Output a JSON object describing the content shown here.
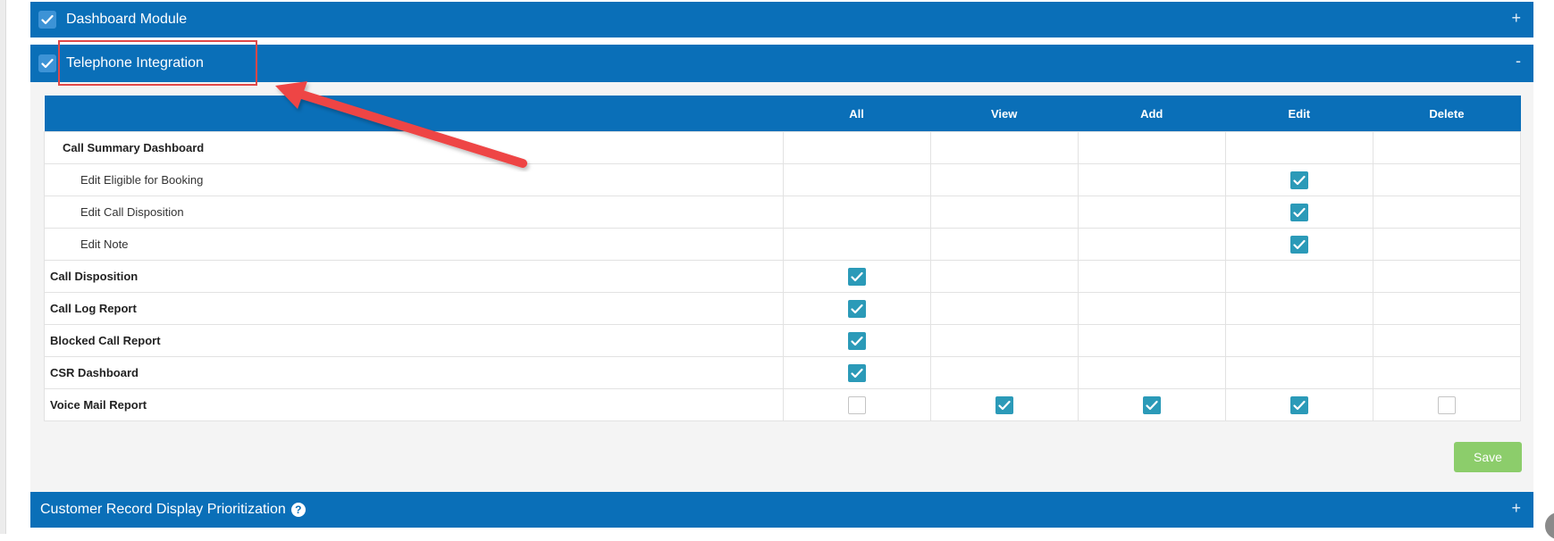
{
  "panels": {
    "dashboard": {
      "title": "Dashboard Module",
      "toggle": "+",
      "checked": true
    },
    "telephone": {
      "title": "Telephone Integration",
      "toggle": "-",
      "checked": true
    },
    "customer": {
      "title": "Customer Record Display Prioritization",
      "toggle": "+",
      "help_icon": "question-circle-icon"
    }
  },
  "table": {
    "columns": [
      "",
      "All",
      "View",
      "Add",
      "Edit",
      "Delete"
    ],
    "rows": [
      {
        "label": "Call Summary Dashboard",
        "style": "section",
        "checks": [
          null,
          null,
          null,
          null,
          null
        ]
      },
      {
        "label": "Edit Eligible for Booking",
        "style": "child",
        "checks": [
          null,
          null,
          null,
          true,
          null
        ]
      },
      {
        "label": "Edit Call Disposition",
        "style": "child",
        "checks": [
          null,
          null,
          null,
          true,
          null
        ]
      },
      {
        "label": "Edit Note",
        "style": "child",
        "checks": [
          null,
          null,
          null,
          true,
          null
        ]
      },
      {
        "label": "Call Disposition",
        "style": "bold",
        "checks": [
          true,
          null,
          null,
          null,
          null
        ]
      },
      {
        "label": "Call Log Report",
        "style": "bold",
        "checks": [
          true,
          null,
          null,
          null,
          null
        ]
      },
      {
        "label": "Blocked Call Report",
        "style": "bold",
        "checks": [
          true,
          null,
          null,
          null,
          null
        ]
      },
      {
        "label": "CSR Dashboard",
        "style": "bold",
        "checks": [
          true,
          null,
          null,
          null,
          null
        ]
      },
      {
        "label": "Voice Mail Report",
        "style": "bold",
        "checks": [
          false,
          true,
          true,
          true,
          false
        ]
      }
    ]
  },
  "actions": {
    "save_label": "Save"
  },
  "colors": {
    "header_blue": "#0a6fb8",
    "checkbox_teal": "#2b9ab8",
    "save_green": "#8ccd6b",
    "annotation_red": "#e04848"
  }
}
